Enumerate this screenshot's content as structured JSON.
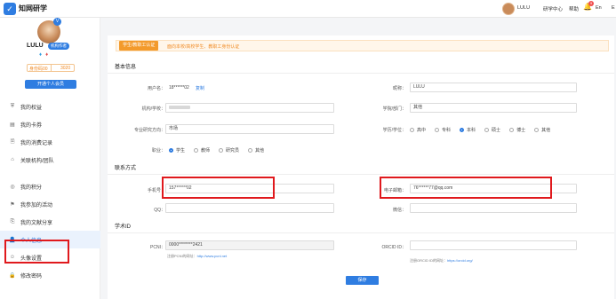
{
  "header": {
    "logo_glyph": "✓",
    "app_name": "知网研学",
    "user": "LULU",
    "center_link": "研学中心",
    "help": "帮助",
    "notification_count": "9",
    "lang": "En",
    "extra": "E"
  },
  "profile": {
    "name": "LULU",
    "tag": "机构作者",
    "verified_glyph": "V",
    "stat_left": "身份码00",
    "stat_right": "3020",
    "vip_button": "开通个人会员"
  },
  "menu": [
    {
      "icon": "shield-icon",
      "glyph": "⛨",
      "label": "我的权益"
    },
    {
      "icon": "card-icon",
      "glyph": "▤",
      "label": "我的卡券"
    },
    {
      "icon": "receipt-icon",
      "glyph": "🗎",
      "label": "我的消费记录"
    },
    {
      "icon": "link-icon",
      "glyph": "⌂",
      "label": "关联机构/团队"
    },
    {
      "icon": "points-icon",
      "glyph": "◎",
      "label": "我的积分"
    },
    {
      "icon": "activity-icon",
      "glyph": "⚑",
      "label": "我参加的活动"
    },
    {
      "icon": "share-icon",
      "glyph": "⎘",
      "label": "我的文献分享"
    },
    {
      "icon": "user-icon",
      "glyph": "👤",
      "label": "个人信息"
    },
    {
      "icon": "avatar-icon",
      "glyph": "☺",
      "label": "头像设置"
    },
    {
      "icon": "lock-icon",
      "glyph": "🔒",
      "label": "修改密码"
    }
  ],
  "alert": {
    "button": "学生/教职工认证",
    "text": "面向本校/高校学生、教职工身份认证"
  },
  "basic": {
    "title": "基本信息",
    "username_label": "用户名：",
    "username_value": "18******02",
    "username_link": "复制",
    "nickname_label": "昵称：",
    "nickname_value": "LULU",
    "org_label": "机构/学校：",
    "dept_label": "学院/部门：",
    "dept_value": "其他",
    "major_label": "专业研究方向：",
    "major_value": "市场",
    "edu_label": "学历/学位：",
    "edu_options": [
      "高中",
      "专科",
      "本科",
      "硕士",
      "博士",
      "其他"
    ],
    "edu_selected": "本科",
    "job_label": "职业：",
    "job_options": [
      "学生",
      "教师",
      "研究员",
      "其他"
    ],
    "job_selected": "学生"
  },
  "contact": {
    "title": "联系方式",
    "phone_label": "手机号：",
    "phone_value": "157******02",
    "email_label": "电子邮箱：",
    "email_value": "76******77@qq.com",
    "qq_label": "QQ：",
    "wechat_label": "微信："
  },
  "scholar": {
    "title": "学术ID",
    "pcn_label": "PCNI：",
    "pcn_value": "0000********2421",
    "pcn_hint": "注册PCNI的网址：",
    "pcn_url": "http://www.pcnl.net",
    "orcid_label": "ORCID ID：",
    "orcid_hint": "注册ORCID ID的网址：",
    "orcid_url": "https://orcid.org/"
  },
  "save_label": "保存",
  "colors": {
    "accent": "#2f7de1",
    "warning": "#f39a2b",
    "highlight": "#e0191d"
  }
}
